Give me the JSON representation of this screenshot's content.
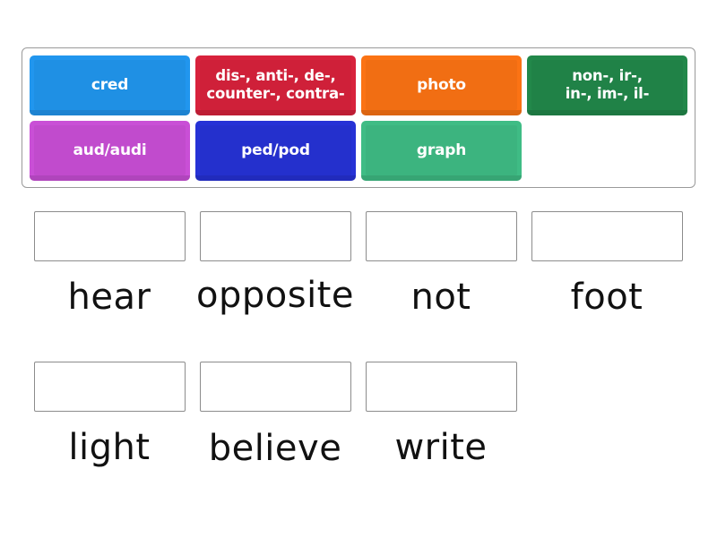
{
  "activity": {
    "type": "match-up",
    "tiles": [
      {
        "id": "cred",
        "label": "cred",
        "color": "#2196ee"
      },
      {
        "id": "dis",
        "label": "dis-, anti-, de-, counter-, contra-",
        "lines": [
          "dis-, anti-, de-,",
          "counter-, contra-"
        ],
        "color": "#d8223c"
      },
      {
        "id": "photo",
        "label": "photo",
        "color": "#fb7314"
      },
      {
        "id": "non",
        "label": "non-, ir-, in-, im-, il-",
        "lines": [
          "non-, ir-,",
          "in-, im-, il-"
        ],
        "color": "#22884a"
      },
      {
        "id": "aud",
        "label": "aud/audi",
        "color": "#c94fd6"
      },
      {
        "id": "ped",
        "label": "ped/pod",
        "color": "#2632d6"
      },
      {
        "id": "graph",
        "label": "graph",
        "color": "#3fbc85"
      }
    ],
    "targets": [
      {
        "id": "t1",
        "label": "hear",
        "value": ""
      },
      {
        "id": "t2",
        "label": "opposite",
        "value": ""
      },
      {
        "id": "t3",
        "label": "not",
        "value": ""
      },
      {
        "id": "t4",
        "label": "foot",
        "value": ""
      },
      {
        "id": "t5",
        "label": "light",
        "value": ""
      },
      {
        "id": "t6",
        "label": "believe",
        "value": ""
      },
      {
        "id": "t7",
        "label": "write",
        "value": ""
      }
    ]
  },
  "colors": {
    "tray_border": "#9a9a9a",
    "drop_border": "#8c8c8c",
    "label_text": "#111111",
    "tile_text": "#ffffff"
  }
}
